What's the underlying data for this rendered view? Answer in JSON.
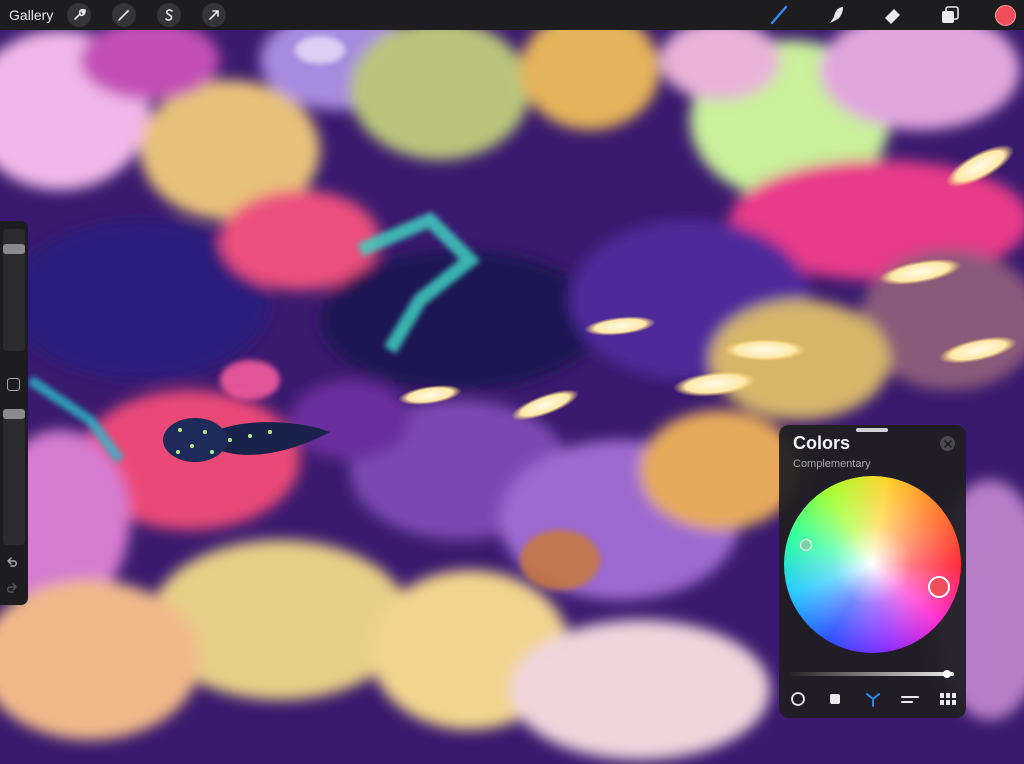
{
  "toolbar": {
    "gallery_label": "Gallery",
    "left_tools": [
      {
        "name": "actions",
        "icon": "wrench-icon"
      },
      {
        "name": "adjustments",
        "icon": "magic-wand-icon"
      },
      {
        "name": "selection",
        "icon": "selection-s-icon"
      },
      {
        "name": "transform",
        "icon": "arrow-cursor-icon"
      }
    ],
    "right_tools": [
      {
        "name": "brush",
        "icon": "brush-icon",
        "active": true
      },
      {
        "name": "smudge",
        "icon": "smudge-icon"
      },
      {
        "name": "eraser",
        "icon": "eraser-icon"
      },
      {
        "name": "layers",
        "icon": "layers-icon"
      }
    ],
    "current_color": "#f24d5a"
  },
  "sidebar": {
    "brush_size_level": 0.87,
    "opacity_level": 1.0,
    "modify_icon": "square-icon",
    "undo_icon": "undo-icon",
    "redo_icon": "redo-icon"
  },
  "colors_panel": {
    "title": "Colors",
    "mode": "Complementary",
    "close_icon": "close-icon",
    "brightness_level": 0.98,
    "tabs": [
      {
        "name": "disc",
        "icon": "disc-icon"
      },
      {
        "name": "classic",
        "icon": "classic-square-icon"
      },
      {
        "name": "harmony",
        "icon": "harmony-icon",
        "active": true
      },
      {
        "name": "value",
        "icon": "value-sliders-icon"
      },
      {
        "name": "palettes",
        "icon": "palettes-grid-icon"
      }
    ],
    "accent": "#2c8cf4"
  }
}
